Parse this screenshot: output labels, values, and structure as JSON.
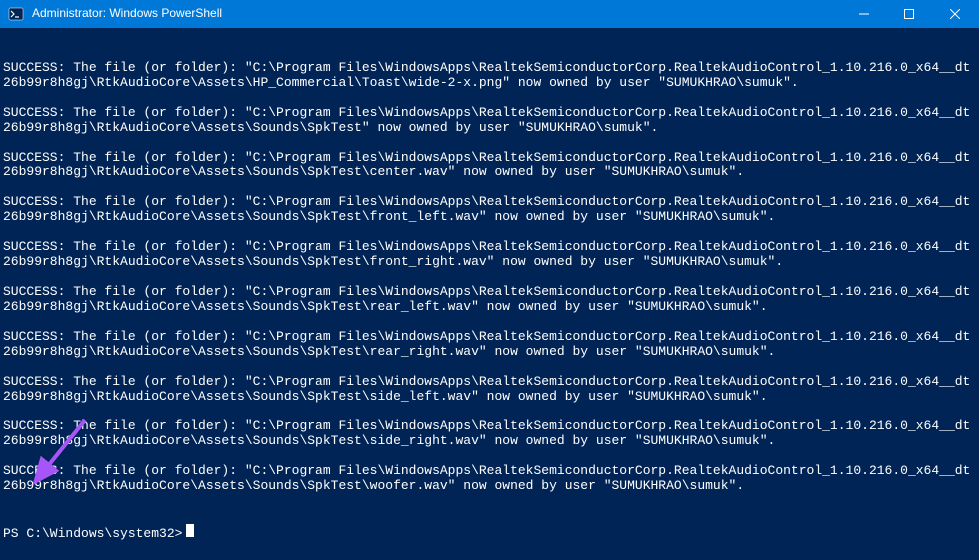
{
  "window": {
    "title": "Administrator: Windows PowerShell"
  },
  "terminal": {
    "lines": [
      "SUCCESS: The file (or folder): \"C:\\Program Files\\WindowsApps\\RealtekSemiconductorCorp.RealtekAudioControl_1.10.216.0_x64__dt26b99r8h8gj\\RtkAudioCore\\Assets\\HP_Commercial\\Toast\\wide-2-x.png\" now owned by user \"SUMUKHRAO\\sumuk\".",
      "",
      "SUCCESS: The file (or folder): \"C:\\Program Files\\WindowsApps\\RealtekSemiconductorCorp.RealtekAudioControl_1.10.216.0_x64__dt26b99r8h8gj\\RtkAudioCore\\Assets\\Sounds\\SpkTest\" now owned by user \"SUMUKHRAO\\sumuk\".",
      "",
      "SUCCESS: The file (or folder): \"C:\\Program Files\\WindowsApps\\RealtekSemiconductorCorp.RealtekAudioControl_1.10.216.0_x64__dt26b99r8h8gj\\RtkAudioCore\\Assets\\Sounds\\SpkTest\\center.wav\" now owned by user \"SUMUKHRAO\\sumuk\".",
      "",
      "SUCCESS: The file (or folder): \"C:\\Program Files\\WindowsApps\\RealtekSemiconductorCorp.RealtekAudioControl_1.10.216.0_x64__dt26b99r8h8gj\\RtkAudioCore\\Assets\\Sounds\\SpkTest\\front_left.wav\" now owned by user \"SUMUKHRAO\\sumuk\".",
      "",
      "SUCCESS: The file (or folder): \"C:\\Program Files\\WindowsApps\\RealtekSemiconductorCorp.RealtekAudioControl_1.10.216.0_x64__dt26b99r8h8gj\\RtkAudioCore\\Assets\\Sounds\\SpkTest\\front_right.wav\" now owned by user \"SUMUKHRAO\\sumuk\".",
      "",
      "SUCCESS: The file (or folder): \"C:\\Program Files\\WindowsApps\\RealtekSemiconductorCorp.RealtekAudioControl_1.10.216.0_x64__dt26b99r8h8gj\\RtkAudioCore\\Assets\\Sounds\\SpkTest\\rear_left.wav\" now owned by user \"SUMUKHRAO\\sumuk\".",
      "",
      "SUCCESS: The file (or folder): \"C:\\Program Files\\WindowsApps\\RealtekSemiconductorCorp.RealtekAudioControl_1.10.216.0_x64__dt26b99r8h8gj\\RtkAudioCore\\Assets\\Sounds\\SpkTest\\rear_right.wav\" now owned by user \"SUMUKHRAO\\sumuk\".",
      "",
      "SUCCESS: The file (or folder): \"C:\\Program Files\\WindowsApps\\RealtekSemiconductorCorp.RealtekAudioControl_1.10.216.0_x64__dt26b99r8h8gj\\RtkAudioCore\\Assets\\Sounds\\SpkTest\\side_left.wav\" now owned by user \"SUMUKHRAO\\sumuk\".",
      "",
      "SUCCESS: The file (or folder): \"C:\\Program Files\\WindowsApps\\RealtekSemiconductorCorp.RealtekAudioControl_1.10.216.0_x64__dt26b99r8h8gj\\RtkAudioCore\\Assets\\Sounds\\SpkTest\\side_right.wav\" now owned by user \"SUMUKHRAO\\sumuk\".",
      "",
      "SUCCESS: The file (or folder): \"C:\\Program Files\\WindowsApps\\RealtekSemiconductorCorp.RealtekAudioControl_1.10.216.0_x64__dt26b99r8h8gj\\RtkAudioCore\\Assets\\Sounds\\SpkTest\\woofer.wav\" now owned by user \"SUMUKHRAO\\sumuk\"."
    ],
    "prompt": "PS C:\\Windows\\system32>"
  }
}
